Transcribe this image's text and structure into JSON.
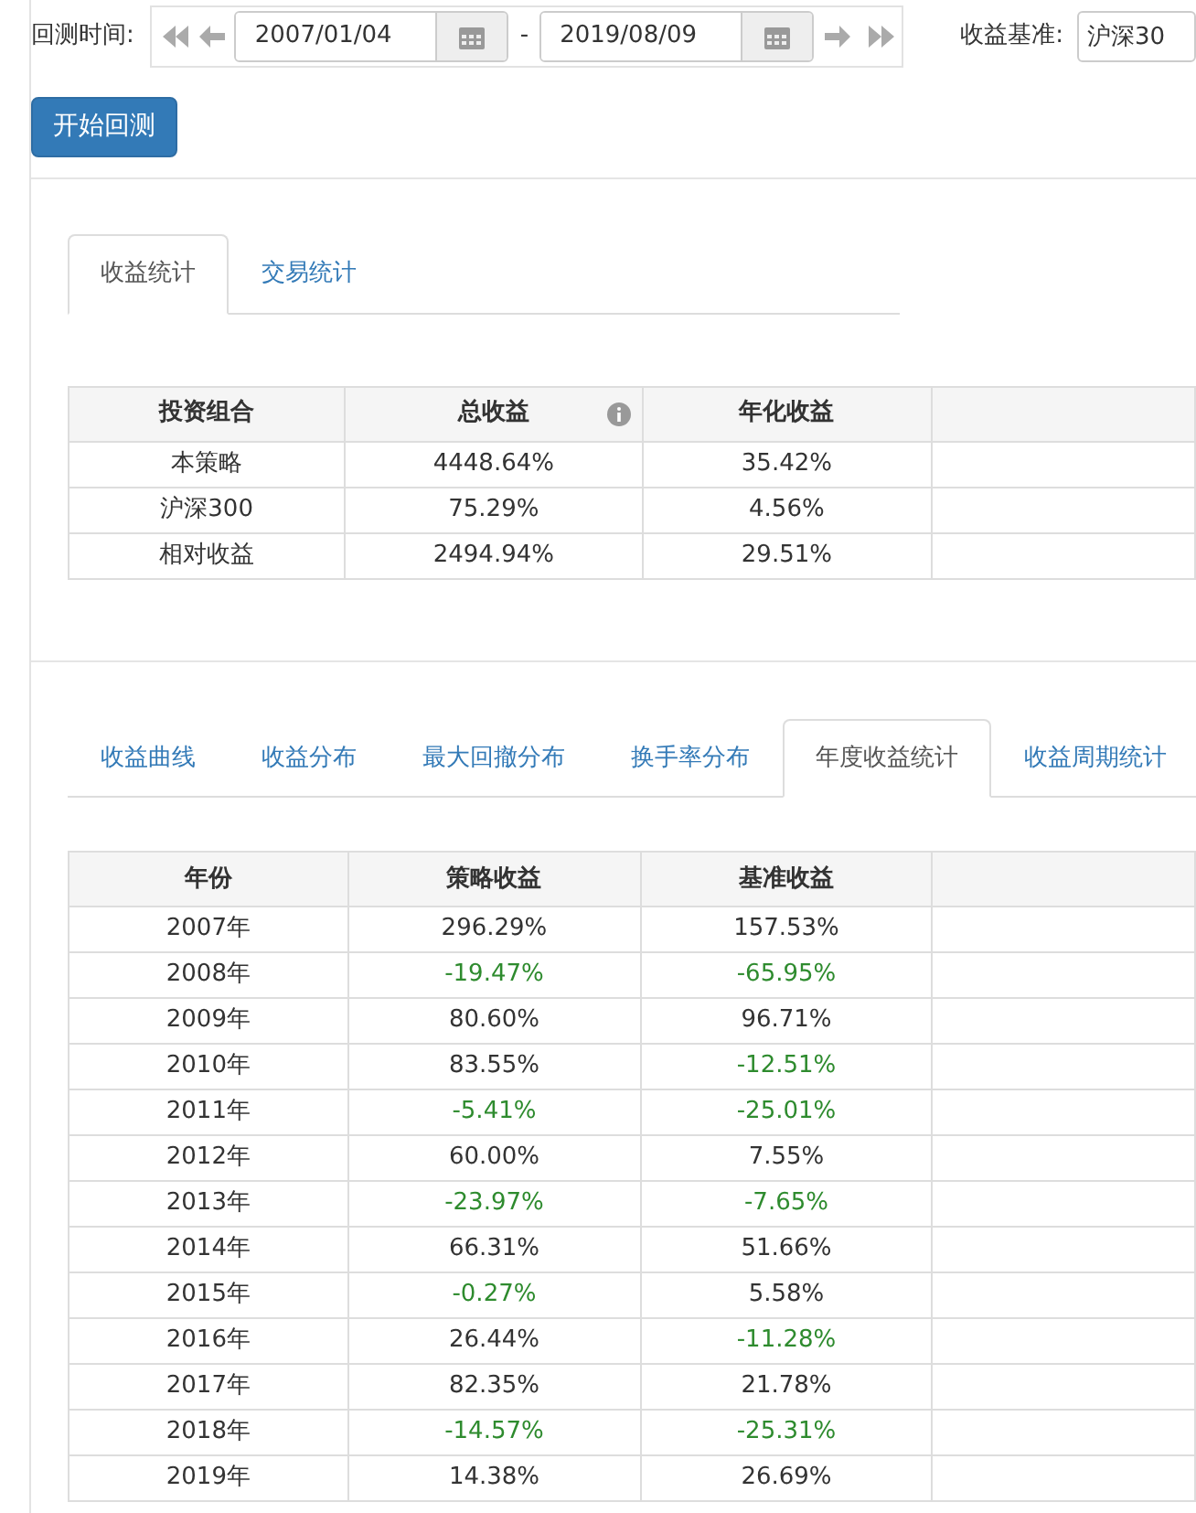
{
  "backtest_time": {
    "label": "回测时间:",
    "start_date": "2007/01/04",
    "separator": "-",
    "end_date": "2019/08/09"
  },
  "benchmark": {
    "label": "收益基准:",
    "value": "沪深30"
  },
  "start_button": "开始回测",
  "stats_tabs": [
    {
      "label": "收益统计",
      "selected": true
    },
    {
      "label": "交易统计",
      "selected": false
    }
  ],
  "stats_table": {
    "columns": [
      {
        "label": "投资组合",
        "info": false
      },
      {
        "label": "总收益",
        "info": true
      },
      {
        "label": "年化收益",
        "info": false
      }
    ],
    "rows": [
      [
        "本策略",
        "4448.64%",
        "35.42%"
      ],
      [
        "沪深300",
        "75.29%",
        "4.56%"
      ],
      [
        "相对收益",
        "2494.94%",
        "29.51%"
      ]
    ]
  },
  "annual_tabs": [
    {
      "label": "收益曲线",
      "selected": false
    },
    {
      "label": "收益分布",
      "selected": false
    },
    {
      "label": "最大回撤分布",
      "selected": false
    },
    {
      "label": "换手率分布",
      "selected": false
    },
    {
      "label": "年度收益统计",
      "selected": true
    },
    {
      "label": "收益周期统计",
      "selected": false
    }
  ],
  "annual_table": {
    "columns": [
      "年份",
      "策略收益",
      "基准收益"
    ],
    "rows": [
      {
        "year": "2007年",
        "strategy": {
          "text": "296.29%",
          "negative": false
        },
        "benchmark": {
          "text": "157.53%",
          "negative": false
        }
      },
      {
        "year": "2008年",
        "strategy": {
          "text": "-19.47%",
          "negative": true
        },
        "benchmark": {
          "text": "-65.95%",
          "negative": true
        }
      },
      {
        "year": "2009年",
        "strategy": {
          "text": "80.60%",
          "negative": false
        },
        "benchmark": {
          "text": "96.71%",
          "negative": false
        }
      },
      {
        "year": "2010年",
        "strategy": {
          "text": "83.55%",
          "negative": false
        },
        "benchmark": {
          "text": "-12.51%",
          "negative": true
        }
      },
      {
        "year": "2011年",
        "strategy": {
          "text": "-5.41%",
          "negative": true
        },
        "benchmark": {
          "text": "-25.01%",
          "negative": true
        }
      },
      {
        "year": "2012年",
        "strategy": {
          "text": "60.00%",
          "negative": false
        },
        "benchmark": {
          "text": "7.55%",
          "negative": false
        }
      },
      {
        "year": "2013年",
        "strategy": {
          "text": "-23.97%",
          "negative": true
        },
        "benchmark": {
          "text": "-7.65%",
          "negative": true
        }
      },
      {
        "year": "2014年",
        "strategy": {
          "text": "66.31%",
          "negative": false
        },
        "benchmark": {
          "text": "51.66%",
          "negative": false
        }
      },
      {
        "year": "2015年",
        "strategy": {
          "text": "-0.27%",
          "negative": true
        },
        "benchmark": {
          "text": "5.58%",
          "negative": false
        }
      },
      {
        "year": "2016年",
        "strategy": {
          "text": "26.44%",
          "negative": false
        },
        "benchmark": {
          "text": "-11.28%",
          "negative": true
        }
      },
      {
        "year": "2017年",
        "strategy": {
          "text": "82.35%",
          "negative": false
        },
        "benchmark": {
          "text": "21.78%",
          "negative": false
        }
      },
      {
        "year": "2018年",
        "strategy": {
          "text": "-14.57%",
          "negative": true
        },
        "benchmark": {
          "text": "-25.31%",
          "negative": true
        }
      },
      {
        "year": "2019年",
        "strategy": {
          "text": "14.38%",
          "negative": false
        },
        "benchmark": {
          "text": "26.69%",
          "negative": false
        }
      }
    ]
  }
}
